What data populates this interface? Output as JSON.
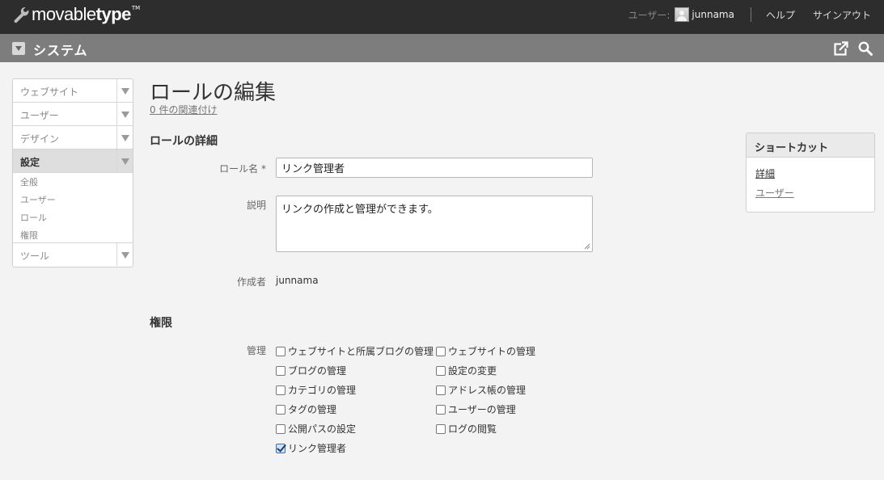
{
  "header": {
    "logo_light": "movable",
    "logo_bold": "type",
    "logo_tm": "TM",
    "user_label": "ユーザー:",
    "username": "junnama",
    "help_link": "ヘルプ",
    "signout_link": "サインアウト"
  },
  "system_bar": {
    "title": "システム",
    "icons": [
      "view-site-icon",
      "search-icon"
    ]
  },
  "sidebar": {
    "items": [
      {
        "label": "ウェブサイト"
      },
      {
        "label": "ユーザー"
      },
      {
        "label": "デザイン"
      },
      {
        "label": "設定",
        "active": true
      },
      {
        "label": "ツール"
      }
    ],
    "settings_sub": [
      "全般",
      "ユーザー",
      "ロール",
      "権限"
    ]
  },
  "main": {
    "title": "ロールの編集",
    "associations_link": "0 件の関連付け",
    "details_heading": "ロールの詳細",
    "role_name_label": "ロール名 *",
    "role_name_value": "リンク管理者",
    "description_label": "説明",
    "description_value": "リンクの作成と管理ができます。",
    "creator_label": "作成者",
    "creator_value": "junnama",
    "permissions_heading": "権限",
    "permissions_group_label": "管理",
    "permissions": [
      {
        "label": "ウェブサイトと所属ブログの管理",
        "checked": false
      },
      {
        "label": "ウェブサイトの管理",
        "checked": false
      },
      {
        "label": "ブログの管理",
        "checked": false
      },
      {
        "label": "設定の変更",
        "checked": false
      },
      {
        "label": "カテゴリの管理",
        "checked": false
      },
      {
        "label": "アドレス帳の管理",
        "checked": false
      },
      {
        "label": "タグの管理",
        "checked": false
      },
      {
        "label": "ユーザーの管理",
        "checked": false
      },
      {
        "label": "公開パスの設定",
        "checked": false
      },
      {
        "label": "ログの閲覧",
        "checked": false
      },
      {
        "label": "リンク管理者",
        "checked": true
      }
    ]
  },
  "shortcut": {
    "title": "ショートカット",
    "links": [
      "詳細",
      "ユーザー"
    ]
  },
  "colors": {
    "topbar": "#2d2d2d",
    "system_bar": "#7d7d7d",
    "background": "#f3f3f3",
    "checkbox_checked": "#cfe3f7"
  }
}
